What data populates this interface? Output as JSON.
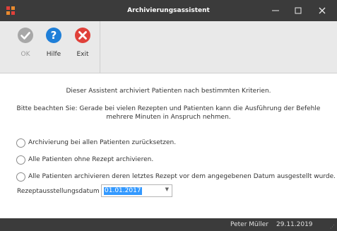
{
  "window": {
    "title": "Archivierungsassistent",
    "minimize_glyph": "—",
    "close_glyph": "✕"
  },
  "toolbar": {
    "ok_label": "OK",
    "help_label": "Hilfe",
    "exit_label": "Exit",
    "ok_enabled": false
  },
  "info": {
    "line1": "Dieser Assistent archiviert Patienten nach bestimmten Kriterien.",
    "line2": "Bitte beachten Sie: Gerade bei vielen Rezepten und Patienten kann die Ausführung der Befehle mehrere Minuten in Anspruch nehmen."
  },
  "options": [
    {
      "label": "Archivierung bei allen Patienten zurücksetzen.",
      "selected": false
    },
    {
      "label": "Alle Patienten ohne Rezept archivieren.",
      "selected": false
    },
    {
      "label": "Alle Patienten archivieren deren letztes Rezept vor dem angegebenen Datum ausgestellt wurde.",
      "selected": false
    }
  ],
  "date_field": {
    "label": "Rezeptausstellungsdatum",
    "value": "01.01.2017"
  },
  "status": {
    "user": "Peter Müller",
    "date": "29.11.2019"
  },
  "colors": {
    "titlebar": "#3b3b3b",
    "toolbar": "#e9e9e9",
    "help_icon": "#1f7fd8",
    "exit_icon": "#e0413a",
    "ok_icon_disabled": "#a8a8a8",
    "selection": "#3399ff"
  },
  "icons": {
    "app": "app-grid-icon",
    "ok": "checkmark-icon",
    "help": "question-icon",
    "exit": "x-circle-icon"
  }
}
